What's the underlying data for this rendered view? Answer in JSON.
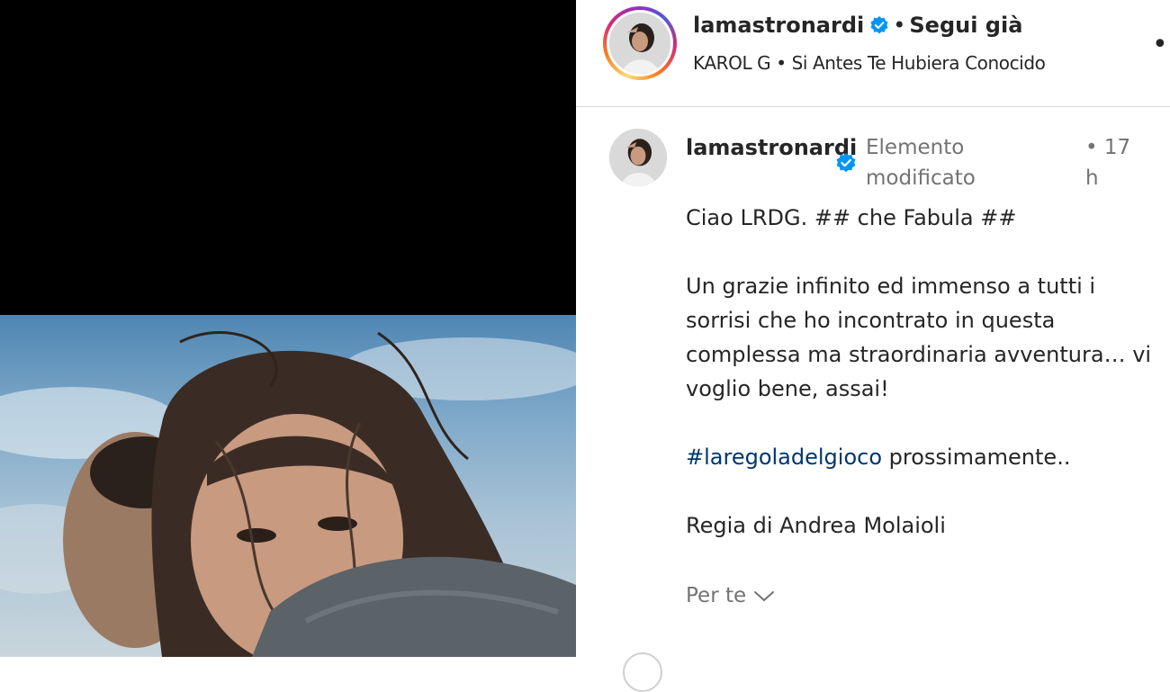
{
  "post": {
    "username": "lamastronardi",
    "follow_status": "Segui già",
    "music": "KAROL G • Si Antes Te Hubiera Conocido",
    "more_icon": "more-horizontal-icon"
  },
  "caption": {
    "username": "lamastronardi",
    "edited_label": "Elemento modificato",
    "time_sep": "•",
    "time": "17 h",
    "lines": {
      "l1": "Ciao LRDG. ## che Fabula ##",
      "l2": "Un grazie infinito ed immenso a tutti i sorrisi che ho incontrato in questa complessa ma straordinaria avventura… vi voglio bene, assai!",
      "hashtag": "#laregoladelgioco",
      "hashtag_suffix": " prossimamente..",
      "l4": "Regia di Andrea Molaioli"
    },
    "translate_label": "Per te"
  },
  "colors": {
    "text": "#262626",
    "secondary": "#737373",
    "hashtag": "#00376b",
    "verified": "#0095f6",
    "divider": "#dbdbdb"
  }
}
